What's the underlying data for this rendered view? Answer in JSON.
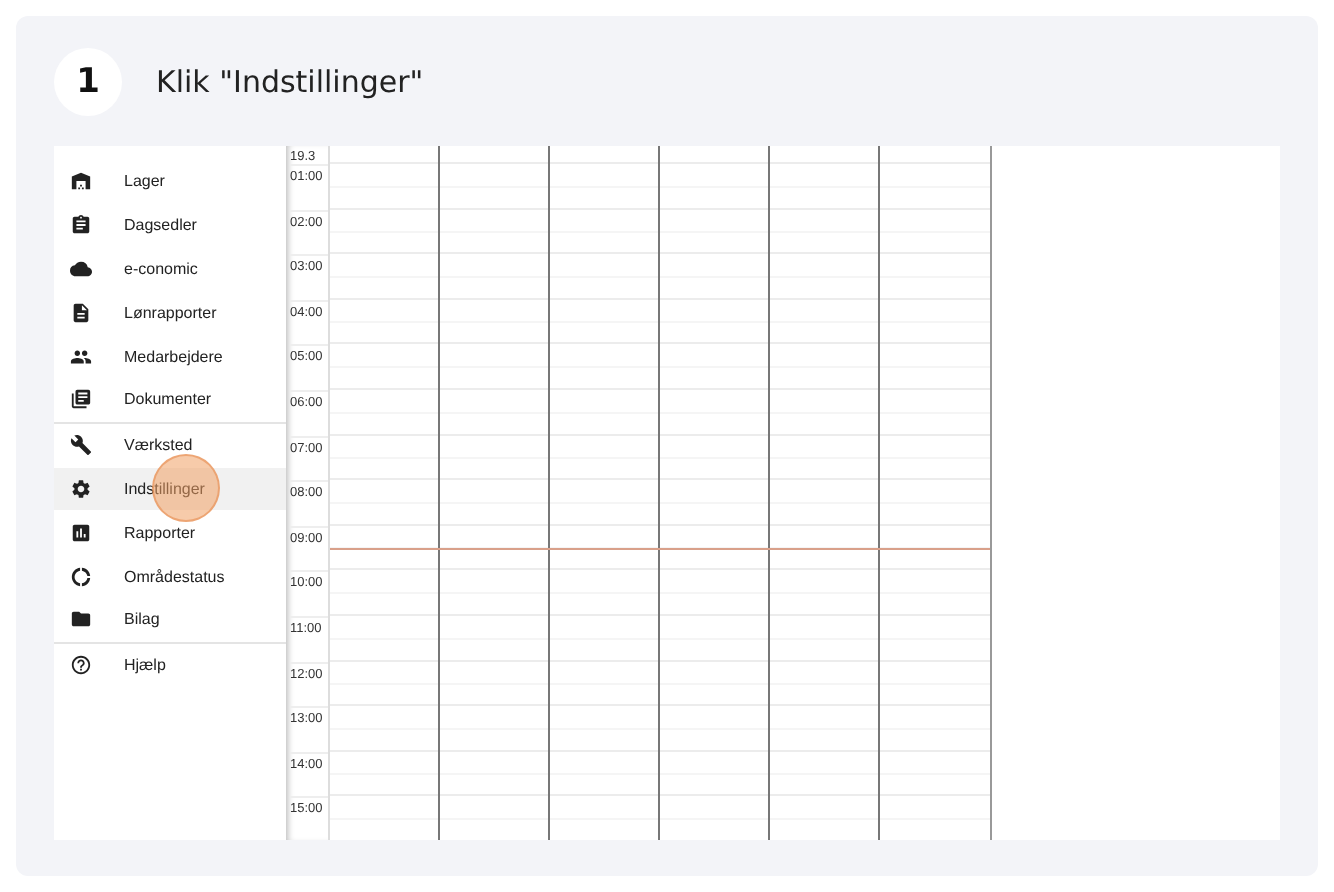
{
  "step": {
    "number": "1",
    "instruction": "Klik \"Indstillinger\""
  },
  "sidebar": {
    "groups": [
      {
        "items": [
          {
            "label": "Lager",
            "selected": false
          },
          {
            "label": "Dagsedler",
            "selected": false
          },
          {
            "label": "e-conomic",
            "selected": false
          },
          {
            "label": "Lønrapporter",
            "selected": false
          },
          {
            "label": "Medarbejdere",
            "selected": false
          },
          {
            "label": "Dokumenter",
            "selected": false
          }
        ]
      },
      {
        "items": [
          {
            "label": "Værksted",
            "selected": false
          },
          {
            "label": "Indstillinger",
            "selected": true
          },
          {
            "label": "Rapporter",
            "selected": false
          },
          {
            "label": "Områdestatus",
            "selected": false
          },
          {
            "label": "Bilag",
            "selected": false
          }
        ]
      },
      {
        "items": [
          {
            "label": "Hjælp",
            "selected": false
          }
        ]
      }
    ]
  },
  "calendar": {
    "date": "19.3",
    "hours": [
      "01:00",
      "02:00",
      "03:00",
      "04:00",
      "05:00",
      "06:00",
      "07:00",
      "08:00",
      "09:00",
      "10:00",
      "11:00",
      "12:00",
      "13:00",
      "14:00",
      "15:00"
    ]
  }
}
